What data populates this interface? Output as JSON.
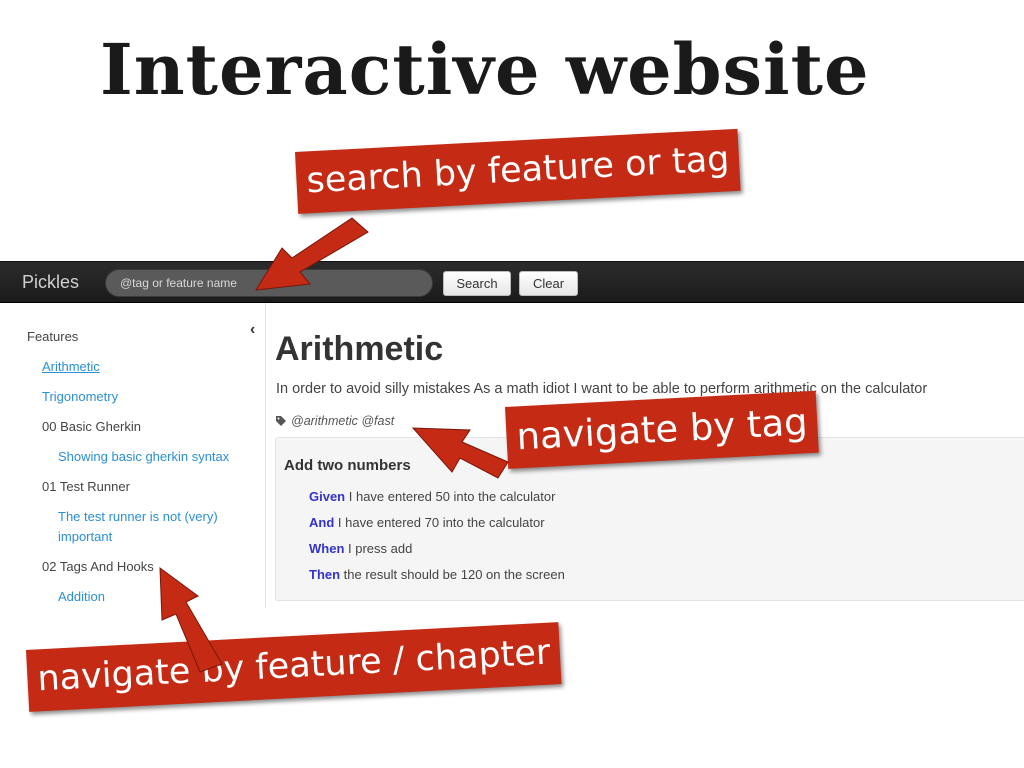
{
  "slide": {
    "title": "Interactive website"
  },
  "navbar": {
    "brand": "Pickles",
    "search_placeholder": "@tag or feature name",
    "search_button": "Search",
    "clear_button": "Clear"
  },
  "sidebar": {
    "heading": "Features",
    "items": [
      {
        "label": "Arithmetic",
        "type": "link",
        "active": true
      },
      {
        "label": "Trigonometry",
        "type": "link"
      },
      {
        "label": "00 Basic Gherkin",
        "type": "folder"
      },
      {
        "label": "Showing basic gherkin syntax",
        "type": "link"
      },
      {
        "label": "01 Test Runner",
        "type": "folder"
      },
      {
        "label": "The test runner is not (very)",
        "type": "link"
      },
      {
        "label": "important",
        "type": "link"
      },
      {
        "label": "02 Tags And Hooks",
        "type": "folder"
      },
      {
        "label": "Addition",
        "type": "link"
      }
    ]
  },
  "feature": {
    "title": "Arithmetic",
    "description": "In order to avoid silly mistakes As a math idiot I want to be able to perform arithmetic on the calculator",
    "tags": "@arithmetic @fast"
  },
  "scenario": {
    "title": "Add two numbers",
    "steps": [
      {
        "keyword": "Given",
        "text": " I have entered 50 into the calculator"
      },
      {
        "keyword": "And",
        "text": " I have entered 70 into the calculator"
      },
      {
        "keyword": "When",
        "text": " I press add"
      },
      {
        "keyword": "Then",
        "text": " the result should be 120 on the screen"
      }
    ]
  },
  "callouts": {
    "search": "search by feature or tag",
    "tag": "navigate by tag",
    "feature": "navigate by feature / chapter"
  },
  "colors": {
    "callout": "#c42a14",
    "link": "#2a8fd6",
    "keyword": "#3333cc",
    "navbar": "#1f1f1f"
  },
  "icons": [
    "tag-icon",
    "chevron-left-icon"
  ]
}
